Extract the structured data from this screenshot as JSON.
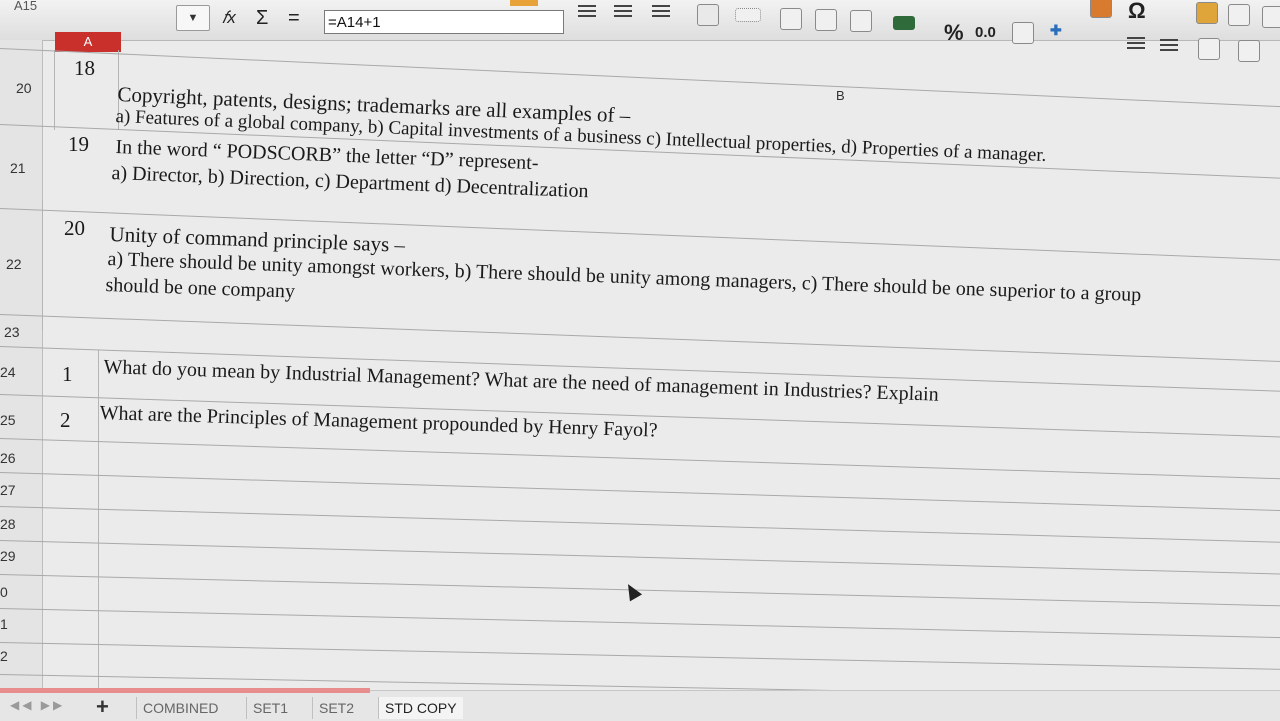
{
  "toolbar": {
    "name_box": "A15",
    "name_dropdown_icon": "chevron-down-icon",
    "function_wizard_glyph": "𝑓x",
    "sum_glyph": "Σ",
    "equals_glyph": "=",
    "formula": "=A14+1",
    "percent_glyph": "%",
    "decimal_glyph": "0.0",
    "omega_glyph": "Ω"
  },
  "columns": {
    "a": "A",
    "b": "B"
  },
  "rows": [
    {
      "num": "20",
      "q": "18",
      "lines": [
        "Copyright, patents, designs; trademarks are all examples of –",
        "a) Features of a global company, b) Capital investments of a business c) Intellectual properties, d) Properties of a manager."
      ]
    },
    {
      "num": "21",
      "q": "19",
      "lines": [
        "In the word “ PODSCORB” the letter “D” represent-",
        "a) Director, b) Direction, c) Department d) Decentralization"
      ]
    },
    {
      "num": "22",
      "q": "20",
      "lines": [
        "Unity of command principle says –",
        "a) There should be unity amongst workers, b) There should be unity among managers, c) There should be one superior to a group",
        "should be one company"
      ]
    },
    {
      "num": "23",
      "q": "",
      "lines": []
    },
    {
      "num": "24",
      "q": "1",
      "lines": [
        "What do you mean by Industrial Management? What are the need of management in Industries? Explain"
      ]
    },
    {
      "num": "25",
      "q": "2",
      "lines": [
        "What are the Principles of Management propounded by Henry Fayol?"
      ]
    }
  ],
  "empty_rows": [
    "26",
    "27",
    "28",
    "29",
    "0",
    "1",
    "2"
  ],
  "sheet_tabs": [
    "COMBINED",
    "SET1",
    "SET2",
    "STD COPY"
  ],
  "active_tab": "STD COPY",
  "add_sheet_glyph": "+"
}
